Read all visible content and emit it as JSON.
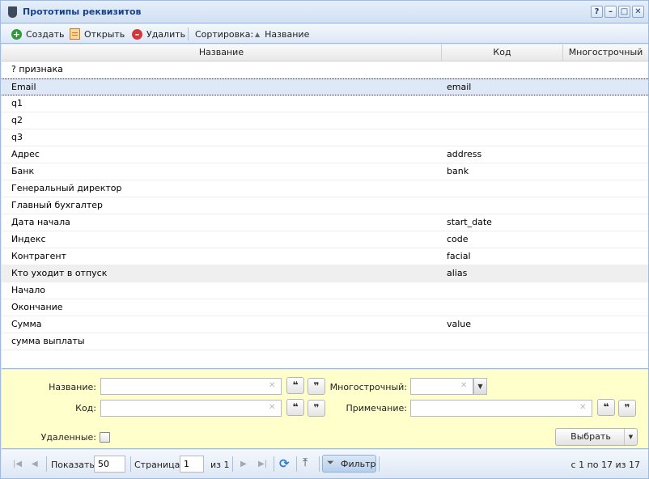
{
  "window": {
    "title": "Прототипы реквизитов",
    "controls": {
      "help": "?",
      "minimize": "–",
      "maximize": "□",
      "close": "✕"
    }
  },
  "toolbar": {
    "create_label": "Создать",
    "open_label": "Открыть",
    "delete_label": "Удалить",
    "sort_label": "Сортировка:",
    "sort_field": "Название"
  },
  "grid": {
    "columns": [
      "Название",
      "Код",
      "Многострочный"
    ],
    "rows": [
      {
        "name": "? признака",
        "code": "",
        "multiline": ""
      },
      {
        "name": "Email",
        "code": "email",
        "multiline": ""
      },
      {
        "name": "q1",
        "code": "",
        "multiline": ""
      },
      {
        "name": "q2",
        "code": "",
        "multiline": ""
      },
      {
        "name": "q3",
        "code": "",
        "multiline": ""
      },
      {
        "name": "Адрес",
        "code": "address",
        "multiline": ""
      },
      {
        "name": "Банк",
        "code": "bank",
        "multiline": ""
      },
      {
        "name": "Генеральный директор",
        "code": "",
        "multiline": ""
      },
      {
        "name": "Главный бухгалтер",
        "code": "",
        "multiline": ""
      },
      {
        "name": "Дата начала",
        "code": "start_date",
        "multiline": ""
      },
      {
        "name": "Индекс",
        "code": "code",
        "multiline": ""
      },
      {
        "name": "Контрагент",
        "code": "facial",
        "multiline": ""
      },
      {
        "name": "Кто уходит в отпуск",
        "code": "alias",
        "multiline": ""
      },
      {
        "name": "Начало",
        "code": "",
        "multiline": ""
      },
      {
        "name": "Окончание",
        "code": "",
        "multiline": ""
      },
      {
        "name": "Сумма",
        "code": "value",
        "multiline": ""
      },
      {
        "name": "сумма выплаты",
        "code": "",
        "multiline": ""
      }
    ],
    "selected_index": 1,
    "hovered_index": 12
  },
  "filter": {
    "name_label": "Название:",
    "name_value": "",
    "code_label": "Код:",
    "code_value": "",
    "multiline_label": "Многострочный:",
    "multiline_value": "",
    "note_label": "Примечание:",
    "note_value": "",
    "deleted_label": "Удаленные:",
    "deleted_checked": false,
    "quote_open": "❝",
    "quote_close": "❞",
    "select_label": "Выбрать"
  },
  "pager": {
    "show_label": "Показать",
    "page_size": "50",
    "page_label": "Страница",
    "current_page": "1",
    "of_label": "из 1",
    "filter_label": "Фильтр",
    "summary": "с 1 по 17 из 17"
  },
  "colors": {
    "title_text": "#15428b",
    "border": "#99bbe8",
    "selected_row": "#dfe8f6",
    "filter_bg": "#ffffcc"
  }
}
